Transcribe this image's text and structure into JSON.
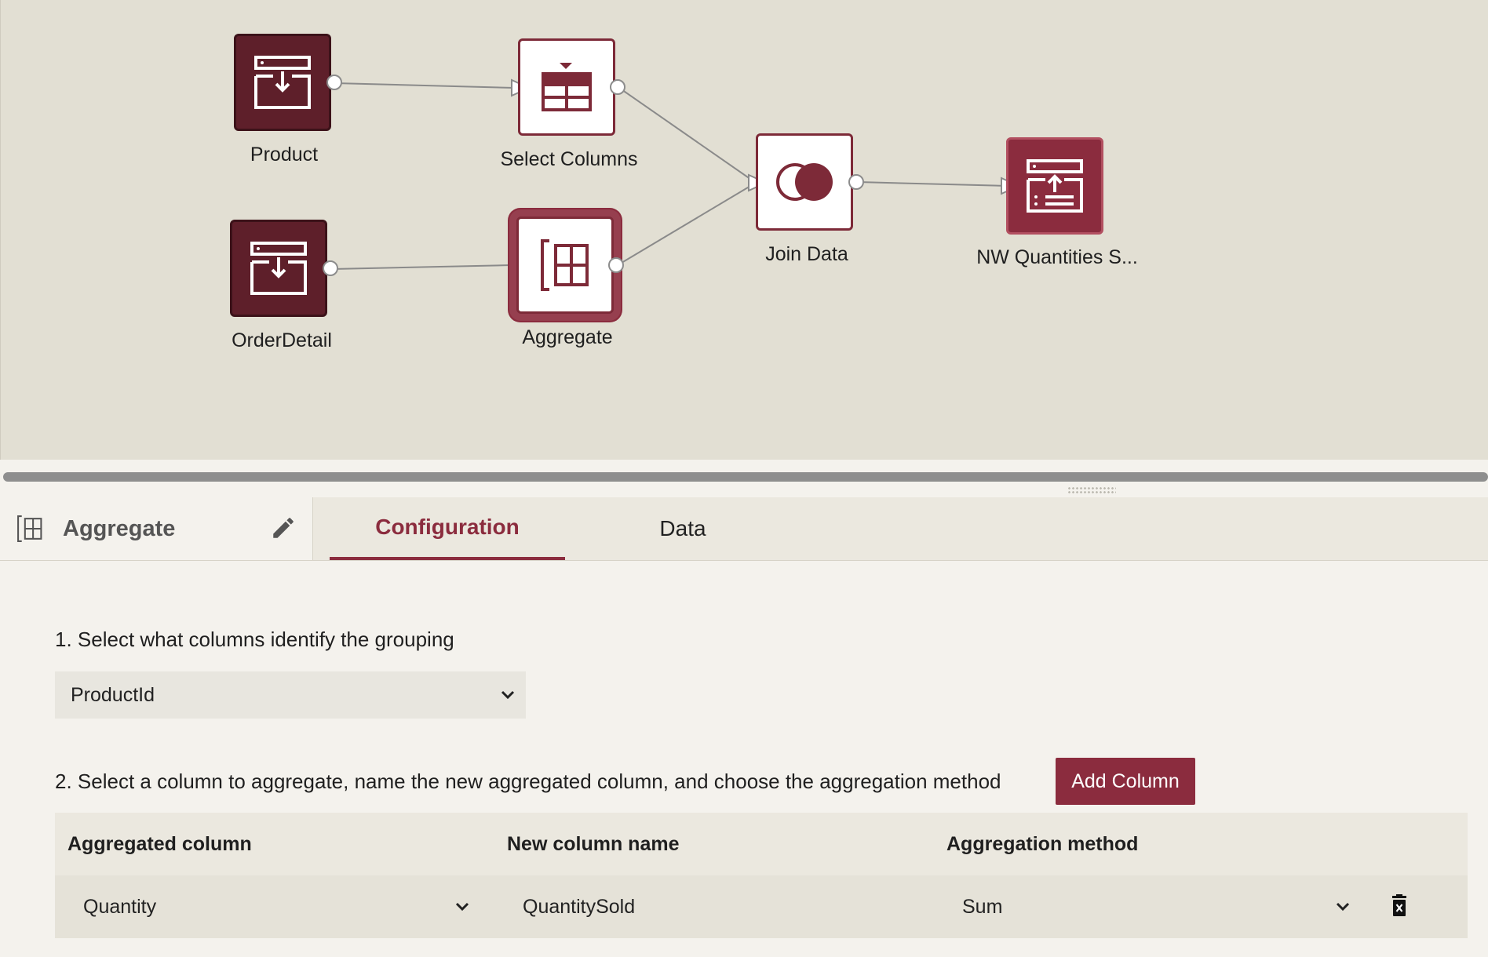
{
  "colors": {
    "brand": "#8b2c3e",
    "node_dark": "#5e1f2a",
    "canvas_bg": "#e2dfd3",
    "panel_bg": "#f4f2ed"
  },
  "flow": {
    "nodes": [
      {
        "id": "product",
        "label": "Product",
        "icon": "dataset-import-icon"
      },
      {
        "id": "select-columns",
        "label": "Select Columns",
        "icon": "table-columns-icon"
      },
      {
        "id": "orderdetail",
        "label": "OrderDetail",
        "icon": "dataset-import-icon"
      },
      {
        "id": "aggregate",
        "label": "Aggregate",
        "icon": "aggregate-icon",
        "selected": true
      },
      {
        "id": "join-data",
        "label": "Join Data",
        "icon": "join-venn-icon"
      },
      {
        "id": "nw-quantities",
        "label": "NW Quantities S...",
        "icon": "dataset-export-icon"
      }
    ]
  },
  "panel": {
    "node_icon": "aggregate-icon",
    "node_title": "Aggregate",
    "edit_icon": "pencil-icon",
    "tabs": [
      "Configuration",
      "Data"
    ],
    "active_tab": "Configuration"
  },
  "config": {
    "step1_label": "1. Select what columns identify the grouping",
    "grouping_value": "ProductId",
    "step2_label": "2. Select a column to aggregate, name the new aggregated column, and choose the aggregation method",
    "add_column_label": "Add Column",
    "table": {
      "headers": [
        "Aggregated column",
        "New column name",
        "Aggregation method"
      ],
      "rows": [
        {
          "aggregated_column": "Quantity",
          "new_column_name": "QuantitySold",
          "method": "Sum",
          "delete_icon": "trash-icon"
        }
      ]
    }
  }
}
